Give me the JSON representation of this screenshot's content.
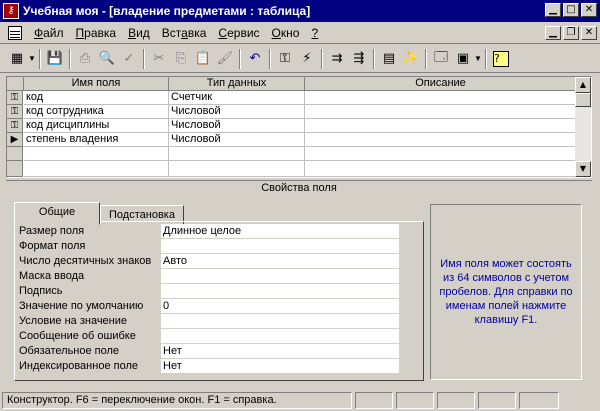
{
  "window": {
    "title": "Учебная моя - [владение предметами : таблица]",
    "icon": "access-key-icon"
  },
  "menu": [
    {
      "label": "Файл",
      "u": "Ф",
      "rest": "айл"
    },
    {
      "label": "Правка",
      "u": "П",
      "rest": "равка"
    },
    {
      "label": "Вид",
      "u": "В",
      "rest": "ид"
    },
    {
      "label": "Вставка",
      "u": "",
      "pre": "Вст",
      "mid": "а",
      "post": "вка"
    },
    {
      "label": "Сервис",
      "u": "С",
      "rest": "ервис"
    },
    {
      "label": "Окно",
      "u": "О",
      "rest": "кно"
    },
    {
      "label": "?",
      "u": "?",
      "rest": ""
    }
  ],
  "grid": {
    "columns": [
      "Имя поля",
      "Тип данных",
      "Описание"
    ],
    "rows": [
      {
        "name": "код",
        "type": "Счетчик",
        "desc": "",
        "key": true,
        "current": false
      },
      {
        "name": "код сотрудника",
        "type": "Числовой",
        "desc": "",
        "key": true,
        "current": false
      },
      {
        "name": "код дисциплины",
        "type": "Числовой",
        "desc": "",
        "key": true,
        "current": false
      },
      {
        "name": "степень владения",
        "type": "Числовой",
        "desc": "",
        "key": false,
        "current": true
      }
    ]
  },
  "properties": {
    "header": "Свойства поля",
    "tabs": [
      "Общие",
      "Подстановка"
    ],
    "items": [
      {
        "label": "Размер поля",
        "value": "Длинное целое"
      },
      {
        "label": "Формат поля",
        "value": ""
      },
      {
        "label": "Число десятичных знаков",
        "value": "Авто"
      },
      {
        "label": "Маска ввода",
        "value": ""
      },
      {
        "label": "Подпись",
        "value": ""
      },
      {
        "label": "Значение по умолчанию",
        "value": "0"
      },
      {
        "label": "Условие на значение",
        "value": ""
      },
      {
        "label": "Сообщение об ошибке",
        "value": ""
      },
      {
        "label": "Обязательное поле",
        "value": "Нет"
      },
      {
        "label": "Индексированное поле",
        "value": "Нет"
      }
    ],
    "help": "Имя поля может состоять из 64 символов с учетом пробелов.  Для справки по именам полей нажмите клавишу F1."
  },
  "status": {
    "text": "Конструктор.  F6 = переключение окон.  F1 = справка."
  },
  "colors": {
    "titlebar": "#000080",
    "help_text": "#0000a0",
    "face": "#d4d0c8"
  }
}
